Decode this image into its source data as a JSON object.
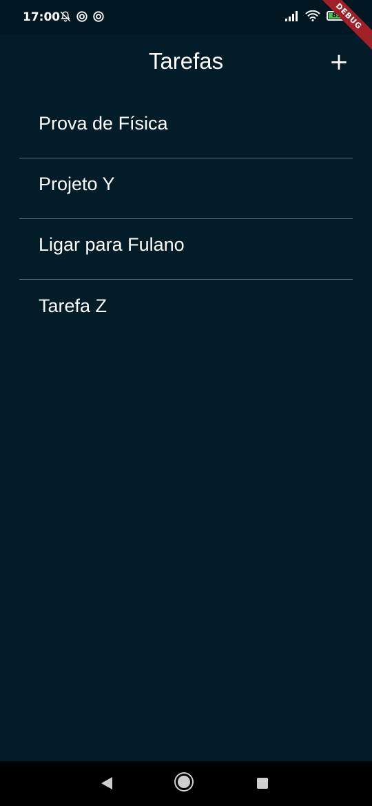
{
  "status_bar": {
    "time": "17:00",
    "icons_left": [
      "bell-off-icon",
      "target-icon",
      "target-icon"
    ],
    "icons_right": [
      "signal-icon",
      "wifi-icon",
      "battery-icon"
    ],
    "battery_level": "83"
  },
  "debug_banner": "DEBUG",
  "app_bar": {
    "title": "Tarefas",
    "add_label": "+"
  },
  "tasks": [
    {
      "label": "Prova de Física"
    },
    {
      "label": "Projeto Y"
    },
    {
      "label": "Ligar para Fulano"
    },
    {
      "label": "Tarefa Z"
    }
  ],
  "colors": {
    "background": "#021c29",
    "divider": "#5f6f78",
    "battery": "#3ecb43",
    "debug_ribbon": "#a0202a"
  },
  "nav_bar": {
    "icons": [
      "back-icon",
      "home-icon",
      "recents-icon"
    ]
  }
}
